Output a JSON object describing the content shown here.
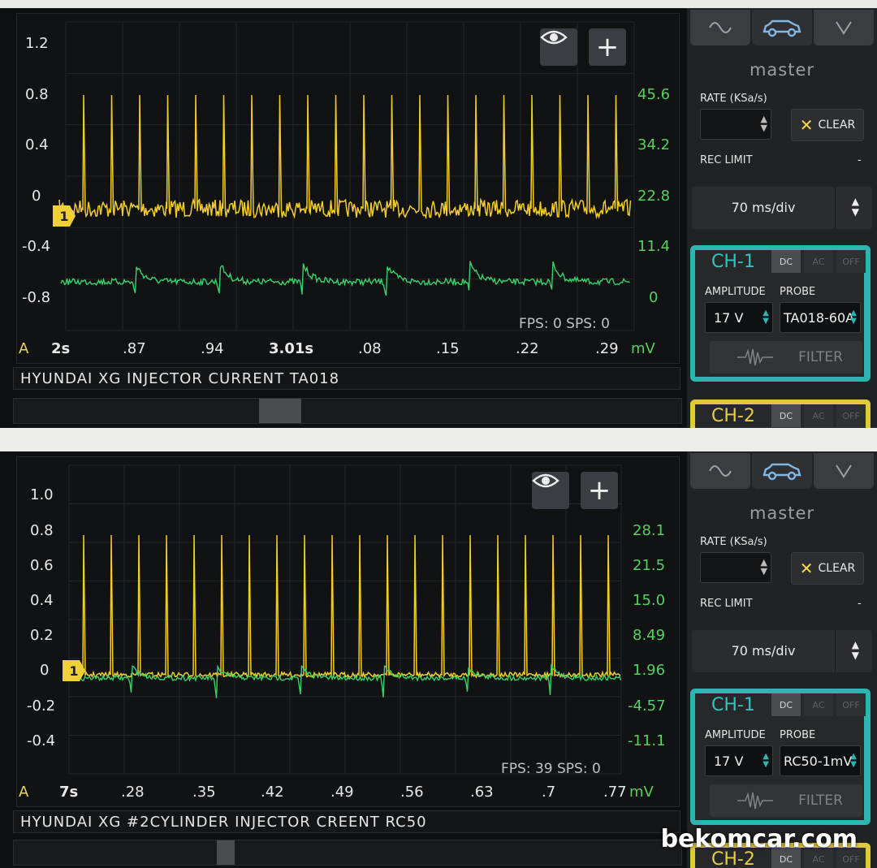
{
  "panels": [
    {
      "left_axis": [
        "1.2",
        "0.8",
        "0.4",
        "0",
        "-0.4",
        "-0.8"
      ],
      "right_axis": [
        "45.6",
        "34.2",
        "22.8",
        "11.4",
        "0"
      ],
      "time_labels": [
        "2s",
        ".87",
        ".94",
        "3.01s",
        ".08",
        ".15",
        ".22",
        ".29"
      ],
      "left_unit": "A",
      "right_unit": "mV",
      "stats": "FPS: 0  SPS: 0",
      "channel_marker": "1",
      "title": "HYUNDAI XG INJECTOR CURRENT TA018",
      "side": {
        "master": "master",
        "rate_label": "RATE (KSa/s)",
        "clear": "CLEAR",
        "rec_limit": "REC LIMIT",
        "rec_value": "-",
        "time_div": "70 ms/div",
        "ch1_name": "CH-1",
        "couplings": [
          "DC",
          "AC",
          "OFF"
        ],
        "amplitude_label": "AMPLITUDE",
        "probe_label": "PROBE",
        "amplitude": "17 V",
        "probe": "TA018-60A",
        "filter": "FILTER",
        "ch2_name": "CH-2"
      }
    },
    {
      "left_axis": [
        "1.0",
        "0.8",
        "0.6",
        "0.4",
        "0.2",
        "0",
        "-0.2",
        "-0.4"
      ],
      "right_axis": [
        "28.1",
        "21.5",
        "15.0",
        "8.49",
        "1.96",
        "-4.57",
        "-11.1"
      ],
      "time_labels": [
        "7s",
        ".28",
        ".35",
        ".42",
        ".49",
        ".56",
        ".63",
        ".7",
        ".77"
      ],
      "left_unit": "A",
      "right_unit": "mV",
      "stats": "FPS: 39  SPS: 0",
      "channel_marker": "1",
      "title": "HYUNDAI XG #2CYLINDER INJECTOR CREENT RC50",
      "side": {
        "master": "master",
        "rate_label": "RATE (KSa/s)",
        "clear": "CLEAR",
        "rec_limit": "REC LIMIT",
        "rec_value": "-",
        "time_div": "70 ms/div",
        "ch1_name": "CH-1",
        "couplings": [
          "DC",
          "AC",
          "OFF"
        ],
        "amplitude_label": "AMPLITUDE",
        "probe_label": "PROBE",
        "amplitude": "17 V",
        "probe": "RC50-1mV",
        "filter": "FILTER",
        "ch2_name": "CH-2"
      }
    }
  ],
  "watermark": "bekomcar.com",
  "colors": {
    "ch1_trace": "#f2cd2a",
    "ch2_trace": "#3bd16a",
    "ch1_accent": "#2fb5b1",
    "ch2_accent": "#e1c93c"
  },
  "icons": [
    "eye-icon",
    "plus-icon",
    "sine-wave-icon",
    "car-icon",
    "chevron-down-icon",
    "filter-wave-icon"
  ]
}
